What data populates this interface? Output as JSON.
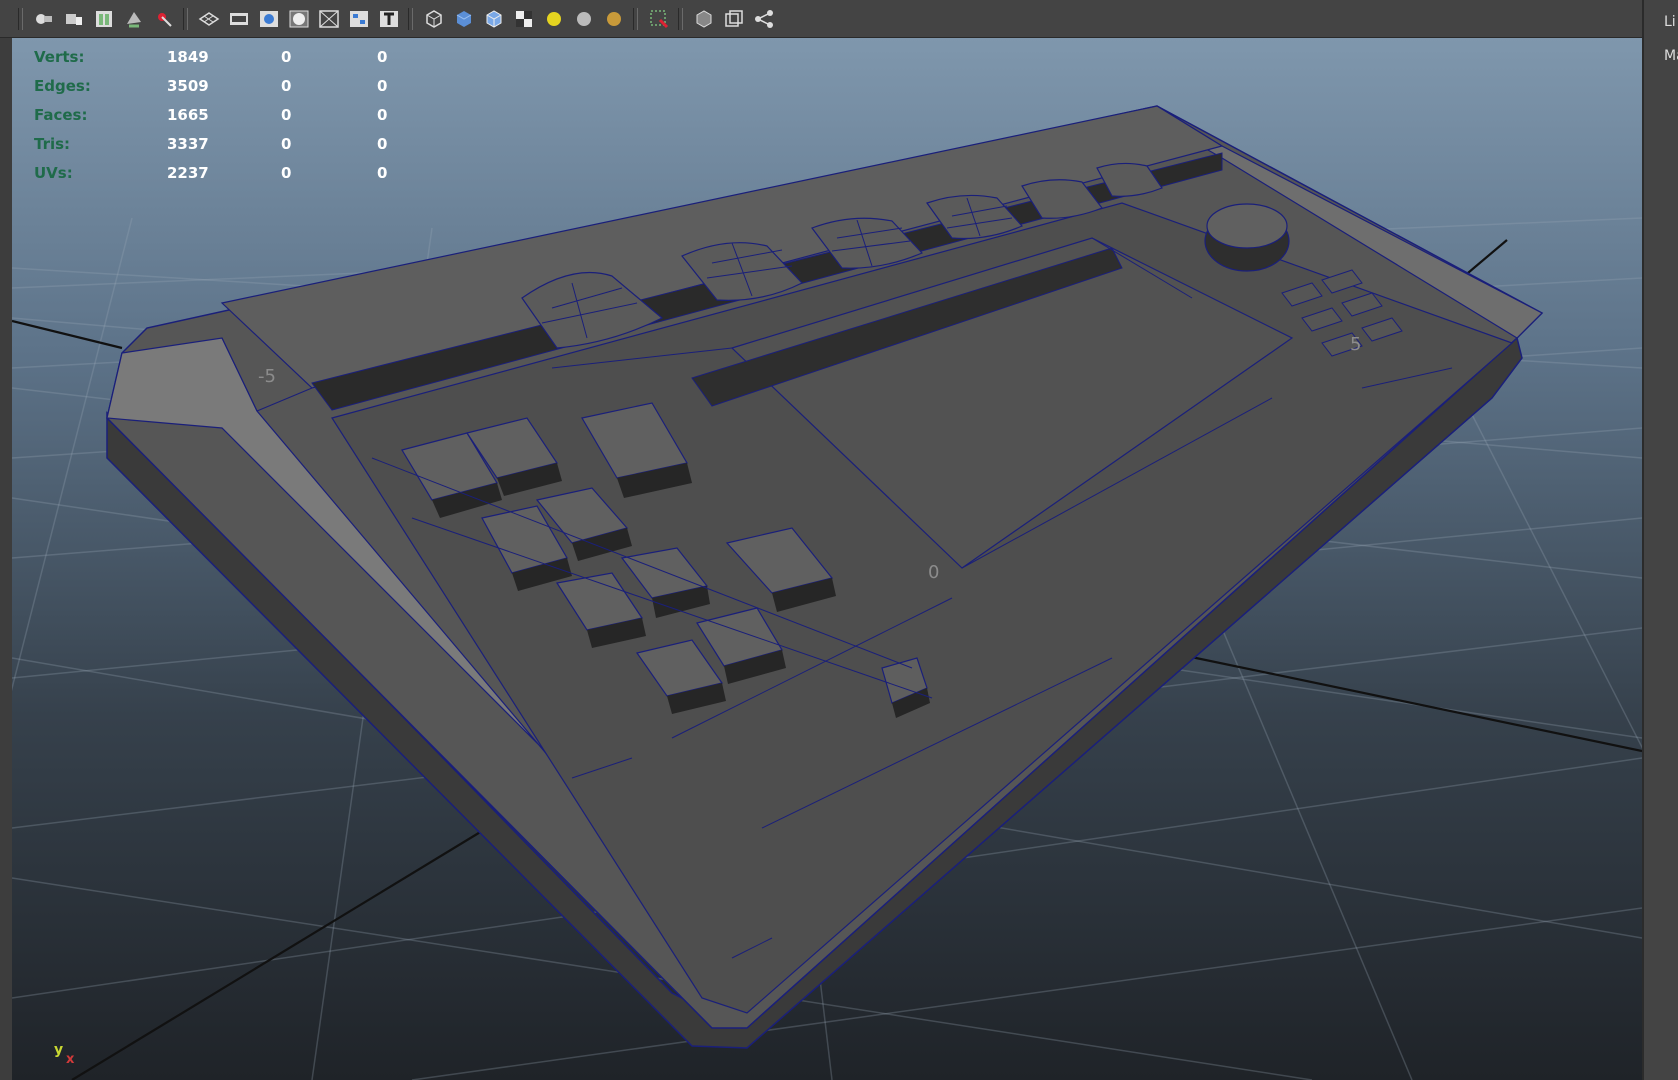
{
  "toolbar": {
    "icons": [
      "camera-attributes-icon",
      "camera-bookmark-icon",
      "image-plane-icon",
      "two-d-pan-zoom-icon",
      "grease-pencil-icon",
      "grid-icon",
      "film-gate-icon",
      "resolution-gate-icon",
      "gate-mask-icon",
      "field-chart-icon",
      "safe-action-icon",
      "safe-title-icon",
      "wireframe-icon",
      "smooth-shade-icon",
      "wireframe-on-shaded-icon",
      "textured-icon",
      "use-all-lights-icon",
      "shadows-icon",
      "ambient-occlusion-icon",
      "isolate-select-icon",
      "xray-icon",
      "xray-joints-icon",
      "xray-components-icon"
    ],
    "accent": "#5b8fd6"
  },
  "hud": {
    "rows": [
      {
        "label": "Verts:",
        "v1": "1849",
        "v2": "0",
        "v3": "0"
      },
      {
        "label": "Edges:",
        "v1": "3509",
        "v2": "0",
        "v3": "0"
      },
      {
        "label": "Faces:",
        "v1": "1665",
        "v2": "0",
        "v3": "0"
      },
      {
        "label": "Tris:",
        "v1": "3337",
        "v2": "0",
        "v3": "0"
      },
      {
        "label": "UVs:",
        "v1": "2237",
        "v2": "0",
        "v3": "0"
      }
    ],
    "label_color": "#1f6b4a"
  },
  "viewport": {
    "grid_numbers": [
      "-5",
      "0",
      "5"
    ],
    "wire_color": "#1a1f7a",
    "mesh_color": "#555555"
  },
  "axis_gizmo": {
    "y": "y",
    "x": "x"
  },
  "right_panel": {
    "labels": [
      "Li",
      "Ma"
    ]
  }
}
